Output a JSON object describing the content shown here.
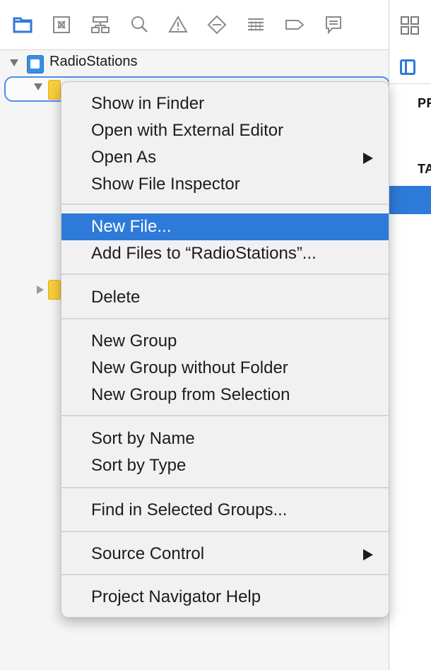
{
  "navigator": {
    "toolbar_icons": [
      "folder-icon",
      "source-control-icon",
      "hierarchy-icon",
      "search-icon",
      "warning-icon",
      "breakpoint-diamond-icon",
      "list-icon",
      "tag-icon",
      "comment-icon"
    ],
    "active_color": "#2e7ad8",
    "project_name": "RadioStations"
  },
  "editor": {
    "text_pr": "PR",
    "text_ta": "TA"
  },
  "context_menu": {
    "highlight_color": "#2e7ad8",
    "items": [
      {
        "label": "Show in Finder"
      },
      {
        "label": "Open with External Editor"
      },
      {
        "label": "Open As",
        "submenu": true
      },
      {
        "label": "Show File Inspector"
      },
      {
        "label": "New File...",
        "highlighted": true
      },
      {
        "label": "Add Files to “RadioStations”..."
      },
      {
        "label": "Delete"
      },
      {
        "label": "New Group"
      },
      {
        "label": "New Group without Folder"
      },
      {
        "label": "New Group from Selection"
      },
      {
        "label": "Sort by Name"
      },
      {
        "label": "Sort by Type"
      },
      {
        "label": "Find in Selected Groups..."
      },
      {
        "label": "Source Control",
        "submenu": true
      },
      {
        "label": "Project Navigator Help"
      }
    ]
  }
}
